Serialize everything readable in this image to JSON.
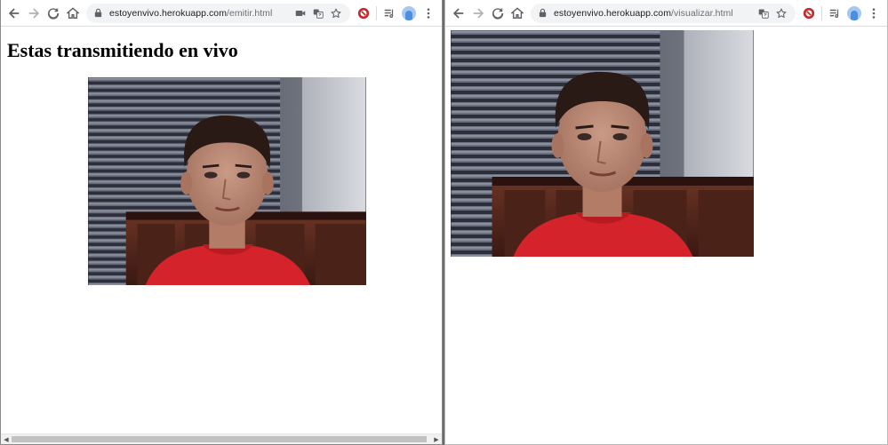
{
  "left_window": {
    "url_host": "estoyenvivo.herokuapp.com",
    "url_path": "/emitir.html",
    "page_title": "Estas transmitiendo en vivo",
    "omnibox_icons": [
      "camera-icon",
      "translate-icon",
      "star-icon"
    ]
  },
  "right_window": {
    "url_host": "estoyenvivo.herokuapp.com",
    "url_path": "/visualizar.html",
    "omnibox_icons": [
      "translate-icon",
      "star-icon"
    ]
  },
  "toolbar_icons": [
    "back-icon",
    "forward-icon",
    "reload-icon",
    "home-icon",
    "lock-icon",
    "extension-icon",
    "reading-list-icon",
    "profile-avatar",
    "menu-icon"
  ],
  "colors": {
    "toolbar_bg": "#ffffff",
    "omnibox_bg": "#f1f3f4",
    "icon": "#5f6368",
    "shirt_red": "#d4232a",
    "headboard": "#5a2a1e"
  }
}
